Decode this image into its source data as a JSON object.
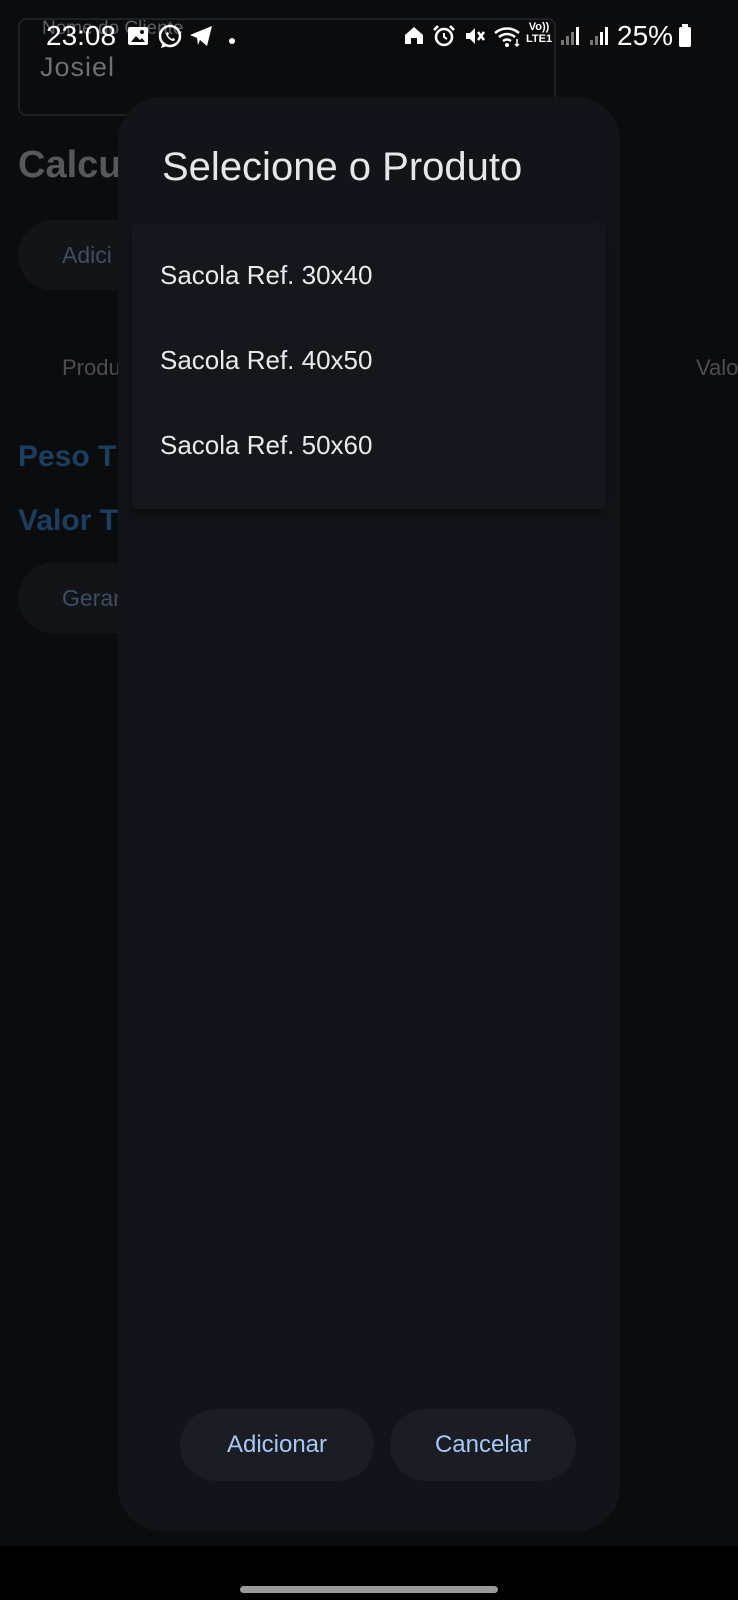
{
  "status_bar": {
    "time": "23:08",
    "battery": "25%",
    "volte_line1": "Vo))",
    "volte_line2": "LTE1",
    "left_icons": [
      "gallery-icon",
      "whatsapp-icon",
      "telegram-icon",
      "dot-icon"
    ],
    "right_icons": [
      "home-icon",
      "alarm-icon",
      "mute-icon",
      "wifi-icon",
      "volte-icon",
      "signal-icon",
      "signal-icon",
      "battery-icon"
    ]
  },
  "background_app": {
    "client_field": {
      "label": "Nome do Cliente",
      "value": "Josiel"
    },
    "title": "Calcu",
    "add_button": "Adici",
    "table_headers": {
      "product": "Produ",
      "value": "Valo"
    },
    "totals": {
      "weight": "Peso T",
      "value": "Valor T"
    },
    "generate_button": "Gerar",
    "accent_color": "#1c3e60"
  },
  "dialog": {
    "title": "Selecione o Produto",
    "products": [
      {
        "label": "Sacola Ref. 30x40"
      },
      {
        "label": "Sacola Ref. 40x50"
      },
      {
        "label": "Sacola Ref. 50x60"
      }
    ],
    "buttons": {
      "add": "Adicionar",
      "cancel": "Cancelar"
    },
    "button_text_color": "#a9c7f5"
  }
}
